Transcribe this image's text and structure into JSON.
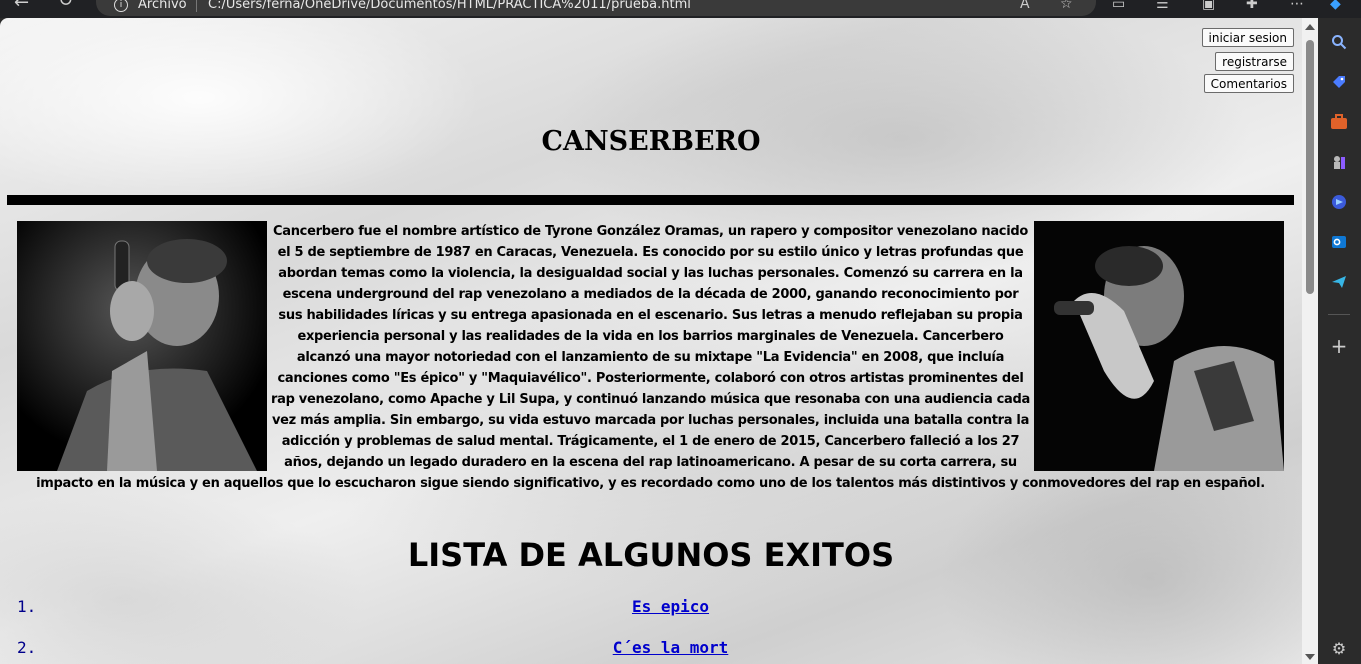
{
  "browser": {
    "address_label": "Archivo",
    "url": "C:/Users/ferna/OneDrive/Documentos/HTML/PRACTICA%2011/prueba.html"
  },
  "auth": {
    "login_label": "iniciar sesion",
    "register_label": "registrarse",
    "comments_label": "Comentarios"
  },
  "header": {
    "title": "CANSERBERO"
  },
  "bio": {
    "text": "Cancerbero fue el nombre artístico de Tyrone González Oramas, un rapero y compositor venezolano nacido el 5 de septiembre de 1987 en Caracas, Venezuela. Es conocido por su estilo único y letras profundas que abordan temas como la violencia, la desigualdad social y las luchas personales. Comenzó su carrera en la escena underground del rap venezolano a mediados de la década de 2000, ganando reconocimiento por sus habilidades líricas y su entrega apasionada en el escenario. Sus letras a menudo reflejaban su propia experiencia personal y las realidades de la vida en los barrios marginales de Venezuela. Cancerbero alcanzó una mayor notoriedad con el lanzamiento de su mixtape \"La Evidencia\" en 2008, que incluía canciones como \"Es épico\" y \"Maquiavélico\". Posteriormente, colaboró con otros artistas prominentes del rap venezolano, como Apache y Lil Supa, y continuó lanzando música que resonaba con una audiencia cada vez más amplia. Sin embargo, su vida estuvo marcada por luchas personales, incluida una batalla contra la adicción y problemas de salud mental. Trágicamente, el 1 de enero de 2015, Cancerbero falleció a los 27 años, dejando un legado duradero en la escena del rap latinoamericano. A pesar de su corta carrera, su impacto en la música y en aquellos que lo escucharon sigue siendo significativo, y es recordado como uno de los talentos más distintivos y conmovedores del rap en español."
  },
  "hits": {
    "title": "LISTA DE ALGUNOS EXITOS",
    "items": [
      {
        "num": "1.",
        "label": "Es epico"
      },
      {
        "num": "2.",
        "label": "C´es la mort"
      }
    ]
  }
}
